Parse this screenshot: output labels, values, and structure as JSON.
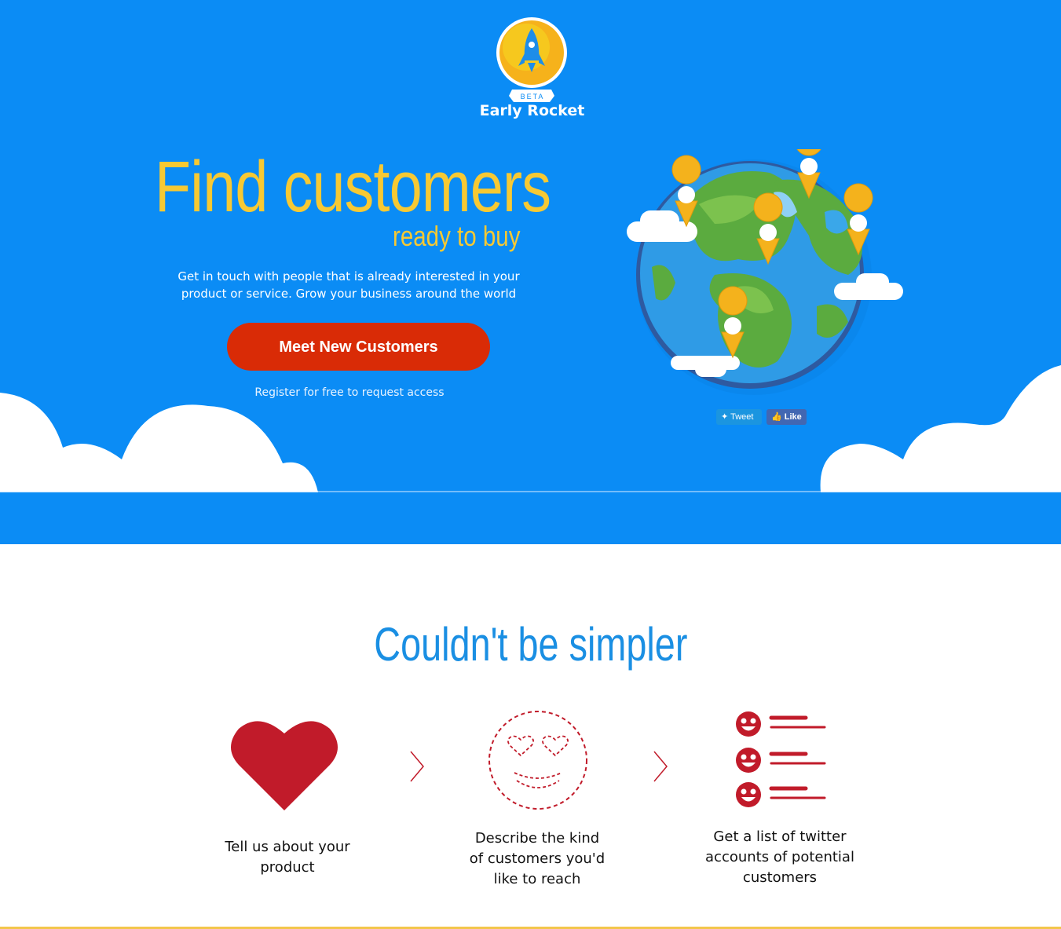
{
  "logo": {
    "name": "Early Rocket",
    "badge": "BETA",
    "icon": "rocket-icon"
  },
  "hero": {
    "title": "Find customers",
    "subtitle": "ready to buy",
    "lead": "Get in touch with people that is already interested in your product or service. Grow your business around the world",
    "cta_label": "Meet New Customers",
    "register_text": "Register for free to request access",
    "illustration": "globe-with-pins"
  },
  "social": {
    "tweet_label": "Tweet",
    "like_label": "Like"
  },
  "section": {
    "title": "Couldn't be simpler",
    "steps": [
      {
        "icon": "heart-icon",
        "label": "Tell us about your product"
      },
      {
        "icon": "smiley-icon",
        "label": "Describe the kind of customers you'd like to reach"
      },
      {
        "icon": "list-icon",
        "label": "Get a list of twitter accounts of potential customers"
      }
    ]
  },
  "colors": {
    "hero_bg": "#0b8cf5",
    "accent_yellow": "#f7c933",
    "cta_red": "#d92b06",
    "section_blue": "#1a8fe3",
    "icon_red": "#c11b2a"
  }
}
